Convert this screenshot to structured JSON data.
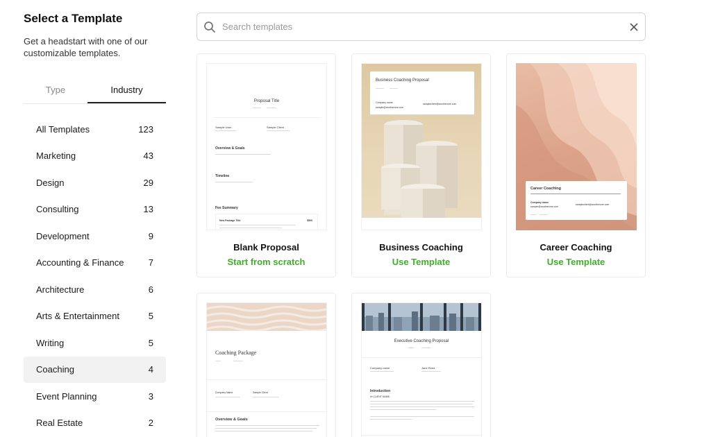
{
  "sidebar": {
    "title": "Select a Template",
    "subtitle": "Get a headstart with one of our customizable templates.",
    "tabs": [
      {
        "label": "Type"
      },
      {
        "label": "Industry"
      }
    ],
    "active_tab": "Industry",
    "categories": [
      {
        "label": "All Templates",
        "count": "123"
      },
      {
        "label": "Marketing",
        "count": "43"
      },
      {
        "label": "Design",
        "count": "29"
      },
      {
        "label": "Consulting",
        "count": "13"
      },
      {
        "label": "Development",
        "count": "9"
      },
      {
        "label": "Accounting & Finance",
        "count": "7"
      },
      {
        "label": "Architecture",
        "count": "6"
      },
      {
        "label": "Arts & Entertainment",
        "count": "5"
      },
      {
        "label": "Writing",
        "count": "5"
      },
      {
        "label": "Coaching",
        "count": "4"
      },
      {
        "label": "Event Planning",
        "count": "3"
      },
      {
        "label": "Real Estate",
        "count": "2"
      }
    ],
    "active_category": "Coaching"
  },
  "search": {
    "placeholder": "Search templates",
    "value": ""
  },
  "colors": {
    "accent_green": "#3fae29",
    "active_bg": "#f2f2f2"
  },
  "icons": {
    "search": "search-icon",
    "clear": "close-icon"
  },
  "cards": [
    {
      "name": "Blank Proposal",
      "action": "Start from scratch",
      "preview": {
        "title": "Proposal Title",
        "from": "Sample User",
        "to": "Sample Client",
        "section1": "Overview & Goals",
        "section2": "Timeline",
        "section3": "Fee Summary",
        "fee_item": "New Package Title",
        "fee_amount": "$500"
      }
    },
    {
      "name": "Business Coaching",
      "action": "Use Template",
      "preview": {
        "title": "Business Coaching Proposal",
        "from": "Company name",
        "email_from": "sample@anotherone.com",
        "email_to": "sampleclient@anotherone.com"
      }
    },
    {
      "name": "Career Coaching",
      "action": "Use Template",
      "preview": {
        "title": "Career Coaching",
        "from": "Company name",
        "email_from": "sample@anotherone.com",
        "email_to": "sampleclient@anotherone.com"
      }
    },
    {
      "name": "",
      "action": "",
      "preview": {
        "title": "Coaching Package",
        "from": "Company Name",
        "to": "Sample Client",
        "section1": "Overview & Goals"
      }
    },
    {
      "name": "",
      "action": "",
      "preview": {
        "title": "Executive Coaching Proposal",
        "from": "Company name",
        "to": "Jane Reed",
        "section1": "Introduction",
        "salutation": "HI CLIENT NAME,"
      }
    }
  ]
}
